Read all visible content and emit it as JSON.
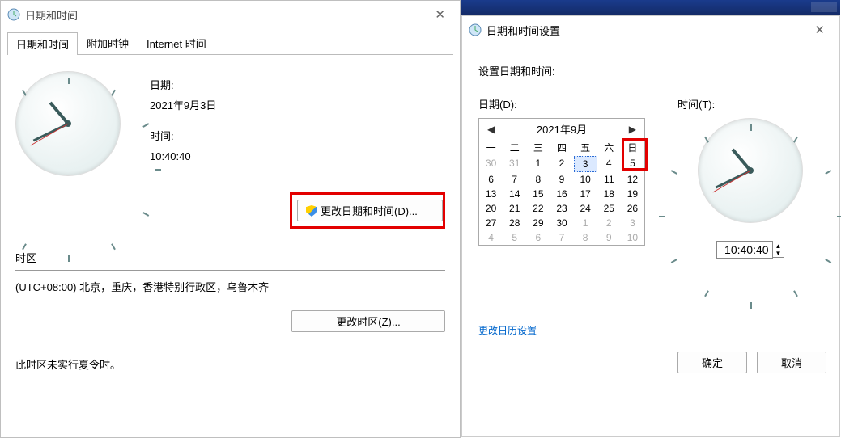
{
  "main": {
    "title": "日期和时间",
    "tabs": [
      "日期和时间",
      "附加时钟",
      "Internet 时间"
    ],
    "date_label": "日期:",
    "date_value": "2021年9月3日",
    "time_label": "时间:",
    "time_value": "10:40:40",
    "change_dt_btn": "更改日期和时间(D)...",
    "tz_label": "时区",
    "tz_value": "(UTC+08:00) 北京，重庆，香港特别行政区，乌鲁木齐",
    "change_tz_btn": "更改时区(Z)...",
    "dst_note": "此时区未实行夏令时。",
    "clock": {
      "hour_angle": 320,
      "min_angle": 244,
      "sec_angle": 240
    }
  },
  "settings": {
    "title": "日期和时间设置",
    "heading": "设置日期和时间:",
    "date_label": "日期(D):",
    "time_label": "时间(T):",
    "month_title": "2021年9月",
    "dow": [
      "一",
      "二",
      "三",
      "四",
      "五",
      "六",
      "日"
    ],
    "weeks": [
      [
        {
          "d": 30,
          "o": true
        },
        {
          "d": 31,
          "o": true
        },
        {
          "d": 1
        },
        {
          "d": 2
        },
        {
          "d": 3,
          "sel": true
        },
        {
          "d": 4
        },
        {
          "d": 5
        }
      ],
      [
        {
          "d": 6
        },
        {
          "d": 7
        },
        {
          "d": 8
        },
        {
          "d": 9
        },
        {
          "d": 10
        },
        {
          "d": 11
        },
        {
          "d": 12
        }
      ],
      [
        {
          "d": 13
        },
        {
          "d": 14
        },
        {
          "d": 15
        },
        {
          "d": 16
        },
        {
          "d": 17
        },
        {
          "d": 18
        },
        {
          "d": 19
        }
      ],
      [
        {
          "d": 20
        },
        {
          "d": 21
        },
        {
          "d": 22
        },
        {
          "d": 23
        },
        {
          "d": 24
        },
        {
          "d": 25
        },
        {
          "d": 26
        }
      ],
      [
        {
          "d": 27
        },
        {
          "d": 28
        },
        {
          "d": 29
        },
        {
          "d": 30
        },
        {
          "d": 1,
          "o": true
        },
        {
          "d": 2,
          "o": true
        },
        {
          "d": 3,
          "o": true
        }
      ],
      [
        {
          "d": 4,
          "o": true
        },
        {
          "d": 5,
          "o": true
        },
        {
          "d": 6,
          "o": true
        },
        {
          "d": 7,
          "o": true
        },
        {
          "d": 8,
          "o": true
        },
        {
          "d": 9,
          "o": true
        },
        {
          "d": 10,
          "o": true
        }
      ]
    ],
    "time_value": "10:40:40",
    "link": "更改日历设置",
    "ok": "确定",
    "cancel": "取消",
    "clock": {
      "hour_angle": 320,
      "min_angle": 244,
      "sec_angle": 240
    }
  }
}
